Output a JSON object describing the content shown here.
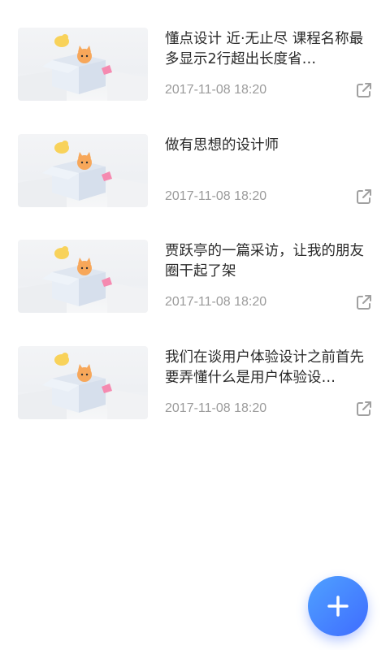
{
  "articles": [
    {
      "title": "懂点设计 近·无止尽 课程名称最多显示2行超出长度省…",
      "date": "2017-11-08 18:20",
      "thumbnail_icon": "box-with-cat-bird-illustration",
      "share_icon": "external-link-icon"
    },
    {
      "title": "做有思想的设计师",
      "date": "2017-11-08 18:20",
      "thumbnail_icon": "box-with-cat-bird-illustration",
      "share_icon": "external-link-icon"
    },
    {
      "title": "贾跃亭的一篇采访，让我的朋友圈干起了架",
      "date": "2017-11-08 18:20",
      "thumbnail_icon": "box-with-cat-bird-illustration",
      "share_icon": "external-link-icon"
    },
    {
      "title": "我们在谈用户体验设计之前首先要弄懂什么是用户体验设…",
      "date": "2017-11-08 18:20",
      "thumbnail_icon": "box-with-cat-bird-illustration",
      "share_icon": "external-link-icon"
    }
  ],
  "fab": {
    "icon": "plus-icon",
    "colors": [
      "#4fa1ff",
      "#3f6cff"
    ]
  },
  "colors": {
    "title": "#2a2a2a",
    "date": "#9b9b9b",
    "icon": "#a0a0a0",
    "background": "#ffffff"
  }
}
